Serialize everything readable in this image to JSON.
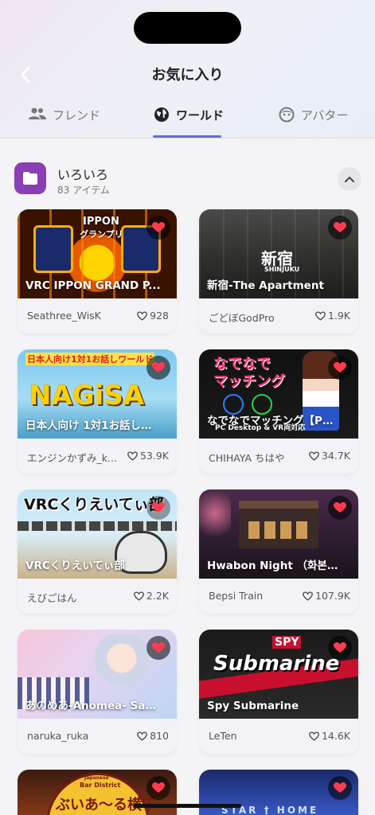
{
  "header": {
    "title": "お気に入り",
    "tabs": [
      {
        "label": "フレンド",
        "icon": "people-icon",
        "active": false
      },
      {
        "label": "ワールド",
        "icon": "globe-icon",
        "active": true
      },
      {
        "label": "アバター",
        "icon": "face-icon",
        "active": false
      }
    ]
  },
  "folder": {
    "name": "いろいろ",
    "count": "83 アイテム",
    "color": "#8a3fb5"
  },
  "worlds": [
    {
      "title": "VRC IPPON GRAND P...",
      "author": "Seathree_WisK",
      "likes": "928",
      "thumb_text": [
        "IPPON",
        "グランプリ"
      ]
    },
    {
      "title": "新宿-The Apartment",
      "author": "ごどぼGodPro",
      "likes": "1.9K",
      "thumb_text": [
        "新宿",
        "SHINJUKU"
      ]
    },
    {
      "title": "日本人向け 1対1お話し…",
      "author": "エンジンかずみ_ka...",
      "likes": "53.9K",
      "thumb_text": [
        "日本人向け1対1お話しワールド",
        "NAGiSA"
      ]
    },
    {
      "title": "なでなでマッチング【P…",
      "author": "CHIHAYA ちはや",
      "likes": "34.7K",
      "thumb_text": [
        "なでなで",
        "マッチング",
        "PC Desktop & VR両対応"
      ]
    },
    {
      "title": "VRCくりえいてぃ部",
      "author": "えびごはん",
      "likes": "2.2K",
      "thumb_text": [
        "VRCくりえいてぃ部"
      ]
    },
    {
      "title": "Hwabon Night （화본…",
      "author": "Bepsi Train",
      "likes": "107.9K",
      "thumb_text": []
    },
    {
      "title": "あのめあ-Anomea- Sa…",
      "author": "naruka_ruka",
      "likes": "810",
      "thumb_text": []
    },
    {
      "title": "Spy Submarine",
      "author": "LeTen",
      "likes": "14.6K",
      "thumb_text": [
        "SPY",
        "Submarine"
      ]
    },
    {
      "title": "",
      "author": "",
      "likes": "",
      "thumb_text": [
        "Japanese",
        "Bar District",
        "ぶいあ〜る横丁"
      ]
    },
    {
      "title": "",
      "author": "",
      "likes": "",
      "thumb_text": [
        "STAR † HOME"
      ]
    }
  ]
}
